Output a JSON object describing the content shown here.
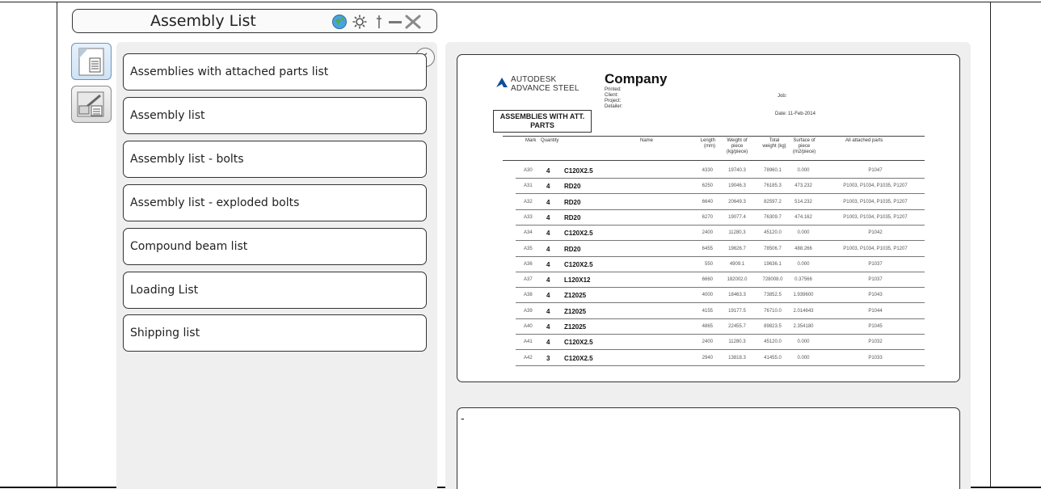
{
  "window": {
    "title": "Assembly List",
    "icons": [
      "globe-icon",
      "gear-icon",
      "pin-icon",
      "minimize-icon",
      "close-icon"
    ]
  },
  "side_tabs": [
    {
      "name": "document-list-tab",
      "active": true
    },
    {
      "name": "drawing-style-tab",
      "active": false
    }
  ],
  "list_items": [
    {
      "label": "Assemblies with attached parts list"
    },
    {
      "label": "Assembly list"
    },
    {
      "label": "Assembly list - bolts"
    },
    {
      "label": "Assembly list - exploded bolts"
    },
    {
      "label": "Compound beam list"
    },
    {
      "label": "Loading List"
    },
    {
      "label": "Shipping list"
    }
  ],
  "preview": {
    "logo_line1": "AUTODESK",
    "logo_line2": "ADVANCE STEEL",
    "company": "Company",
    "printed": "Printed:",
    "client": "Client:",
    "project": "Project:",
    "detailer": "Detailer:",
    "job": "Job:",
    "date_label": "Date:",
    "date_value": "11-Feb-2014",
    "doc_title_line1": "ASSEMBLIES WITH ATT.",
    "doc_title_line2": "PARTS",
    "columns": [
      "Mark",
      "Quantity",
      "Name",
      "Length (mm)",
      "Weight of piece (kg/piece)",
      "Total weight (kg)",
      "Surface of piece (m2/piece)",
      "All attached parts"
    ],
    "rows": [
      {
        "mark": "A30",
        "qty": "4",
        "name": "C120X2.5",
        "length": "4330",
        "weight": "19740.3",
        "total": "78960.1",
        "surface": "0.000",
        "parts": "P1047"
      },
      {
        "mark": "A31",
        "qty": "4",
        "name": "RD20",
        "length": "6250",
        "weight": "19046.3",
        "total": "76185.3",
        "surface": "473.232",
        "parts": "P1003, P1034, P1035, P1207"
      },
      {
        "mark": "A32",
        "qty": "4",
        "name": "RD20",
        "length": "6640",
        "weight": "20649.3",
        "total": "82597.2",
        "surface": "514.232",
        "parts": "P1003, P1034, P1035, P1207"
      },
      {
        "mark": "A33",
        "qty": "4",
        "name": "RD20",
        "length": "6270",
        "weight": "19077.4",
        "total": "76309.7",
        "surface": "474.162",
        "parts": "P1003, P1034, P1035, P1207"
      },
      {
        "mark": "A34",
        "qty": "4",
        "name": "C120X2.5",
        "length": "2400",
        "weight": "11280.3",
        "total": "45120.0",
        "surface": "0.000",
        "parts": "P1042"
      },
      {
        "mark": "A35",
        "qty": "4",
        "name": "RD20",
        "length": "6455",
        "weight": "19626.7",
        "total": "78506.7",
        "surface": "488.266",
        "parts": "P1003, P1034, P1035, P1207"
      },
      {
        "mark": "A36",
        "qty": "4",
        "name": "C120X2.5",
        "length": "550",
        "weight": "4909.1",
        "total": "19636.1",
        "surface": "0.000",
        "parts": "P1037"
      },
      {
        "mark": "A37",
        "qty": "4",
        "name": "L120X12",
        "length": "6660",
        "weight": "182002.0",
        "total": "728008.0",
        "surface": "0.37566",
        "parts": "P1037"
      },
      {
        "mark": "A38",
        "qty": "4",
        "name": "Z12025",
        "length": "4000",
        "weight": "18463.3",
        "total": "73852.5",
        "surface": "1.939600",
        "parts": "P1043"
      },
      {
        "mark": "A39",
        "qty": "4",
        "name": "Z12025",
        "length": "4155",
        "weight": "19177.5",
        "total": "76710.0",
        "surface": "2.014643",
        "parts": "P1044"
      },
      {
        "mark": "A40",
        "qty": "4",
        "name": "Z12025",
        "length": "4865",
        "weight": "22455.7",
        "total": "89823.5",
        "surface": "2.354180",
        "parts": "P1045"
      },
      {
        "mark": "A41",
        "qty": "4",
        "name": "C120X2.5",
        "length": "2400",
        "weight": "11280.3",
        "total": "45120.0",
        "surface": "0.000",
        "parts": "P1032"
      },
      {
        "mark": "A42",
        "qty": "3",
        "name": "C120X2.5",
        "length": "2940",
        "weight": "13818.3",
        "total": "41455.0",
        "surface": "0.000",
        "parts": "P1033"
      }
    ]
  },
  "description": "-"
}
